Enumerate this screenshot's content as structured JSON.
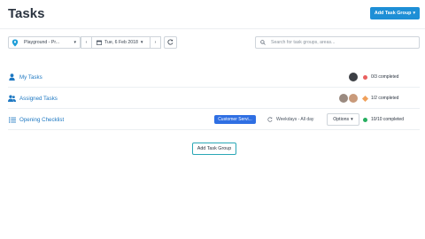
{
  "header": {
    "title": "Tasks",
    "add_group_label": "Add Task Group",
    "add_group_caret": "▾"
  },
  "toolbar": {
    "location": "Playground - Pr...",
    "location_caret": "▾",
    "prev": "‹",
    "date": "Tue, 6 Feb 2018",
    "date_caret": "▾",
    "next": "›",
    "search_placeholder": "Search for task groups, areas..."
  },
  "task_groups": [
    {
      "name": "My Tasks",
      "status": "0/3 completed",
      "status_color": "#e9605f",
      "icon": "person-icon"
    },
    {
      "name": "Assigned Tasks",
      "status": "1/2 completed",
      "status_color": "#f0a05a",
      "icon": "people-icon"
    },
    {
      "name": "Opening Checklist",
      "status": "10/10 completed",
      "status_color": "#27ae60",
      "icon": "list-icon",
      "tag": "Customer Servi...",
      "recurrence": "Weekdays - All day",
      "options_label": "Options",
      "options_caret": "▾"
    }
  ],
  "footer": {
    "add_group_label": "Add Task Group"
  },
  "colors": {
    "accent": "#1e8fd6",
    "tag": "#2f6fe3",
    "link": "#1e78c2"
  }
}
